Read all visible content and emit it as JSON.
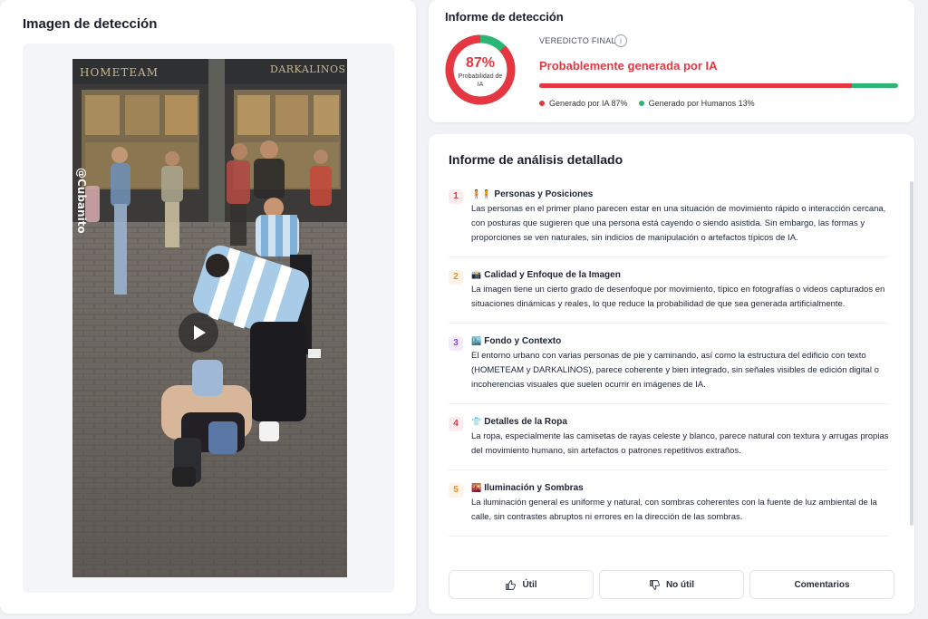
{
  "left": {
    "title": "Imagen de detección"
  },
  "video": {
    "sign_left": "HOMETEAM",
    "sign_right": "DARKALINOS",
    "watermark": "@Cubanito"
  },
  "report": {
    "title": "Informe de detección",
    "gauge": {
      "percent_value": 87,
      "percent": "87%",
      "label": "Probabilidad de IA"
    },
    "verdict_label": "VEREDICTO FINAL",
    "verdict": "Probablemente generada por IA",
    "ai_share": 0.87,
    "legend": {
      "ai": "Generado por IA 87%",
      "human": "Generado por Humanos 13%"
    },
    "colors": {
      "ai": "#e53641",
      "human": "#2bb673"
    }
  },
  "detail": {
    "title": "Informe de análisis detallado",
    "items": [
      {
        "num": "1",
        "emoji": "🧍🧍",
        "title": "Personas y Posiciones",
        "body": "Las personas en el primer plano parecen estar en una situación de movimiento rápido o interacción cercana, con posturas que sugieren que una persona está cayendo o siendo asistida. Sin embargo, las formas y proporciones se ven naturales, sin indicios de manipulación o artefactos típicos de IA.",
        "color": "#e53641",
        "bg": "#fdecee"
      },
      {
        "num": "2",
        "emoji": "📸",
        "title": "Calidad y Enfoque de la Imagen",
        "body": "La imagen tiene un cierto grado de desenfoque por movimiento, típico en fotografías o videos capturados en situaciones dinámicas y reales, lo que reduce la probabilidad de que sea generada artificialmente.",
        "color": "#e8912a",
        "bg": "#fdf3e6"
      },
      {
        "num": "3",
        "emoji": "🏙️",
        "title": "Fondo y Contexto",
        "body": "El entorno urbano con varias personas de pie y caminando, así como la estructura del edificio con texto (HOMETEAM y DARKALINOS), parece coherente y bien integrado, sin señales visibles de edición digital o incoherencias visuales que suelen ocurrir en imágenes de IA.",
        "color": "#8b4bd8",
        "bg": "#f3ecfc"
      },
      {
        "num": "4",
        "emoji": "👕",
        "title": "Detalles de la Ropa",
        "body": "La ropa, especialmente las camisetas de rayas celeste y blanco, parece natural con textura y arrugas propias del movimiento humano, sin artefactos o patrones repetitivos extraños.",
        "color": "#e53641",
        "bg": "#fdecee"
      },
      {
        "num": "5",
        "emoji": "🌇",
        "title": "Iluminación y Sombras",
        "body": "La iluminación general es uniforme y natural, con sombras coherentes con la fuente de luz ambiental de la calle, sin contrastes abruptos ni errores en la dirección de las sombras.",
        "color": "#e8912a",
        "bg": "#fdf3e6"
      }
    ],
    "footer": {
      "useful": "Útil",
      "not_useful": "No útil",
      "comments": "Comentarios"
    }
  }
}
